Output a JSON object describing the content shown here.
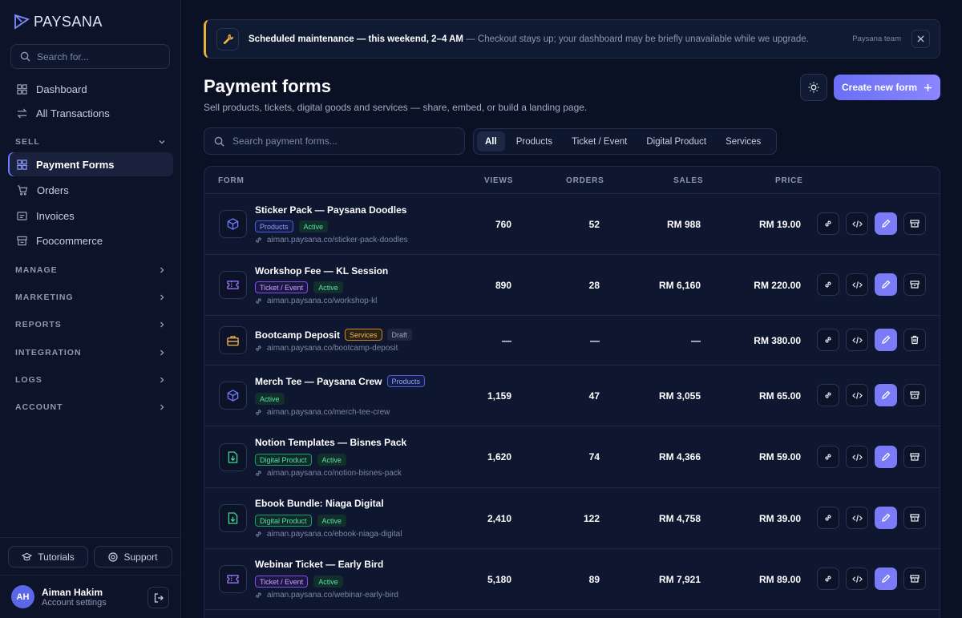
{
  "app": {
    "name": "PAYSANA"
  },
  "sidebar": {
    "search_placeholder": "Search for...",
    "top_items": [
      {
        "label": "Dashboard",
        "icon": "grid-icon"
      },
      {
        "label": "All Transactions",
        "icon": "arrows-icon"
      }
    ],
    "sell_label": "SELL",
    "sell_items": [
      {
        "label": "Payment Forms",
        "icon": "grid-icon",
        "active": true
      },
      {
        "label": "Orders",
        "icon": "cart-icon"
      },
      {
        "label": "Invoices",
        "icon": "invoice-icon"
      },
      {
        "label": "Foocommerce",
        "icon": "store-icon"
      }
    ],
    "sections": [
      "MANAGE",
      "MARKETING",
      "REPORTS",
      "INTEGRATION",
      "LOGS",
      "ACCOUNT"
    ],
    "tutorials": "Tutorials",
    "support": "Support",
    "user": {
      "initials": "AH",
      "name": "Aiman Hakim",
      "sub": "Account settings"
    }
  },
  "banner": {
    "title": "Scheduled maintenance — this weekend, 2–4 AM",
    "text": "— Checkout stays up; your dashboard may be briefly unavailable while we upgrade.",
    "team": "Paysana team"
  },
  "page": {
    "title": "Payment forms",
    "subtitle": "Sell products, tickets, digital goods and services — share, embed, or build a landing page.",
    "create_label": "Create new form",
    "search_placeholder": "Search payment forms...",
    "filters": [
      "All",
      "Products",
      "Ticket / Event",
      "Digital Product",
      "Services"
    ]
  },
  "table": {
    "headers": {
      "form": "FORM",
      "views": "VIEWS",
      "orders": "ORDERS",
      "sales": "SALES",
      "price": "PRICE"
    },
    "rows": [
      {
        "name": "Sticker Pack — Paysana Doodles",
        "type": "Products",
        "status": "Active",
        "url": "aiman.paysana.co/sticker-pack-doodles",
        "views": "760",
        "orders": "52",
        "sales": "RM 988",
        "price": "RM 19.00"
      },
      {
        "name": "Workshop Fee — KL Session",
        "type": "Ticket / Event",
        "status": "Active",
        "url": "aiman.paysana.co/workshop-kl",
        "views": "890",
        "orders": "28",
        "sales": "RM 6,160",
        "price": "RM 220.00"
      },
      {
        "name": "Bootcamp Deposit",
        "type": "Services",
        "status": "Draft",
        "url": "aiman.paysana.co/bootcamp-deposit",
        "views": "—",
        "orders": "—",
        "sales": "—",
        "price": "RM 380.00"
      },
      {
        "name": "Merch Tee — Paysana Crew",
        "type": "Products",
        "status": "Active",
        "url": "aiman.paysana.co/merch-tee-crew",
        "views": "1,159",
        "orders": "47",
        "sales": "RM 3,055",
        "price": "RM 65.00"
      },
      {
        "name": "Notion Templates — Bisnes Pack",
        "type": "Digital Product",
        "status": "Active",
        "url": "aiman.paysana.co/notion-bisnes-pack",
        "views": "1,620",
        "orders": "74",
        "sales": "RM 4,366",
        "price": "RM 59.00"
      },
      {
        "name": "Ebook Bundle: Niaga Digital",
        "type": "Digital Product",
        "status": "Active",
        "url": "aiman.paysana.co/ebook-niaga-digital",
        "views": "2,410",
        "orders": "122",
        "sales": "RM 4,758",
        "price": "RM 39.00"
      },
      {
        "name": "Webinar Ticket — Early Bird",
        "type": "Ticket / Event",
        "status": "Active",
        "url": "aiman.paysana.co/webinar-early-bird",
        "views": "5,180",
        "orders": "89",
        "sales": "RM 7,921",
        "price": "RM 89.00"
      }
    ]
  }
}
